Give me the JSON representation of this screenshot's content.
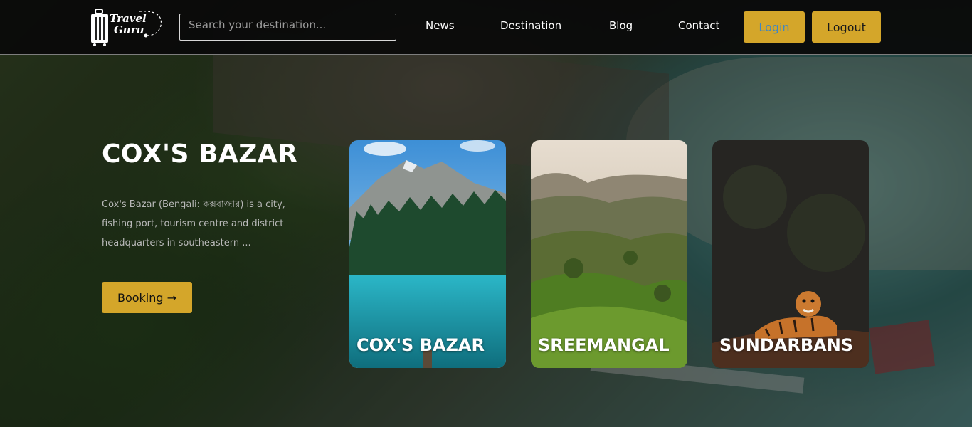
{
  "brand": {
    "line1": "Travel",
    "line2": "Guru"
  },
  "search": {
    "placeholder": "Search your destination..."
  },
  "nav": {
    "news": "News",
    "destination": "Destination",
    "blog": "Blog",
    "contact": "Contact"
  },
  "auth": {
    "login": "Login",
    "logout": "Logout"
  },
  "hero": {
    "title": "COX'S BAZAR",
    "description": "Cox's Bazar (Bengali: কক্সবাজার) is a city, fishing port, tourism centre and district headquarters in southeastern ...",
    "booking": "Booking →"
  },
  "cards": [
    {
      "label": "COX'S BAZAR"
    },
    {
      "label": "SREEMANGAL"
    },
    {
      "label": "SUNDARBANS"
    }
  ],
  "colors": {
    "accent": "#d4a62a",
    "login_text": "#3f86c4",
    "nav_bg": "#0a0a0a"
  },
  "icons": {
    "logo": "suitcase-icon"
  }
}
